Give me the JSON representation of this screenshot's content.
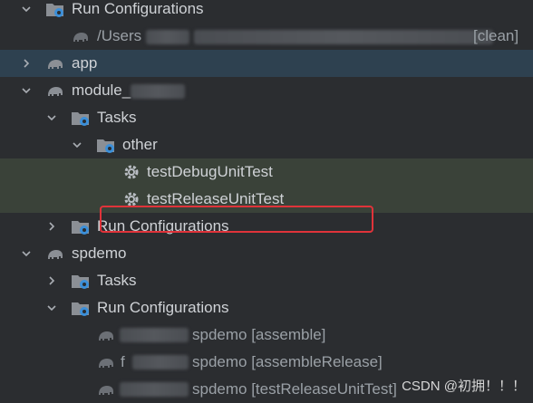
{
  "tree": {
    "row0": {
      "label": "Run Configurations"
    },
    "row1": {
      "prefix": "/Users",
      "suffix": "[clean]"
    },
    "row2": {
      "label": "app"
    },
    "row3": {
      "label": "module_"
    },
    "row4": {
      "label": "Tasks"
    },
    "row5": {
      "label": "other"
    },
    "row6": {
      "label": "testDebugUnitTest"
    },
    "row7": {
      "label": "testReleaseUnitTest"
    },
    "row8": {
      "label": "Run Configurations"
    },
    "row9": {
      "label": "spdemo"
    },
    "row10": {
      "label": "Tasks"
    },
    "row11": {
      "label": "Run Configurations"
    },
    "row12": {
      "label": "spdemo [assemble]"
    },
    "row13": {
      "prefix": "f",
      "label": "spdemo [assembleRelease]"
    },
    "row14": {
      "label": "spdemo [testReleaseUnitTest]"
    }
  },
  "watermark": "CSDN @初拥！！！",
  "colors": {
    "highlight": "#e0333a",
    "selected": "#2e4150",
    "match": "#3a4239",
    "gear": "#b8bcc2",
    "folder": "#8b8f95",
    "badge": "#3b8fd9"
  }
}
